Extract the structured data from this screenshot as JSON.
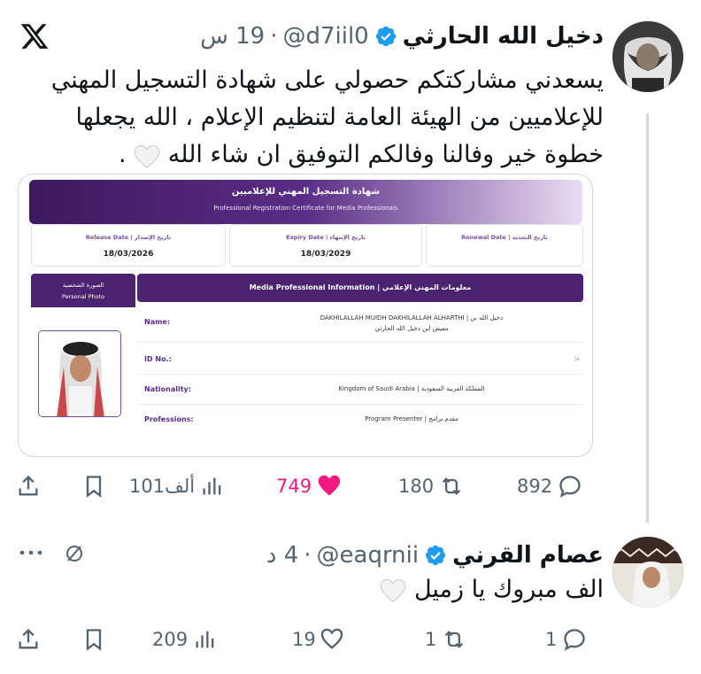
{
  "tweet": {
    "author_name": "دخيل الله الحارثي",
    "handle": "@d7iil0",
    "separator": "·",
    "time": "19 س",
    "text_line1": "يسعدني مشاركتكم حصولي على شهادة التسجيل المهني",
    "text_line2": "للإعلاميين من الهيئة العامة لتنظيم الإعلام ، الله يجعلها",
    "text_line3": "خطوة خير وفالنا وفالكم التوفيق ان شاء الله",
    "text_end": ".",
    "stats": {
      "replies": "892",
      "retweets": "180",
      "likes": "749",
      "views": "101ألف"
    }
  },
  "certificate": {
    "title_ar": "شهادة التسجيل المهني للإعلاميين",
    "title_en": "Professional Registration Certificate for Media Professionals",
    "release_label": "Release Date | تاريخ الإصدار",
    "release_date": "18/03/2026",
    "expiry_label": "Expiry Date | تاريخ الإنتهاء",
    "expiry_date": "18/03/2029",
    "renewal_label": "Renewal Date | تاريخ التجديد",
    "photo_label_ar": "الصورة الشخصية",
    "photo_label_en": "Personal Photo",
    "info_header": "Media Professional Information | معلومات المهني الإعلامي",
    "name_label": "Name:",
    "name_value_line1": "DAKHILALLAH MUIDH DAKHILALLAH ALHARTHI | دخيل الله بن",
    "name_value_line2": "معيض ابن دخيل الله الحارثي",
    "id_label": "ID No.:",
    "id_value": ">",
    "nationality_label": "Nationality:",
    "nationality_value": "Kingdom of Saudi Arabia | المملكة العربية السعودية",
    "professions_label": "Professions:",
    "professions_value": "Program Presenter | مقدم برامج"
  },
  "reply": {
    "author_name": "عصام القرني",
    "handle": "@eaqrnii",
    "separator": "·",
    "time": "4 د",
    "text": "الف مبروك يا زميل",
    "stats": {
      "replies": "1",
      "retweets": "1",
      "likes": "19",
      "views": "209"
    }
  },
  "colors": {
    "text": "#0f1419",
    "muted": "#536471",
    "verified": "#1d9bf0",
    "like": "#f91880",
    "cert_purple": "#4b2370"
  }
}
